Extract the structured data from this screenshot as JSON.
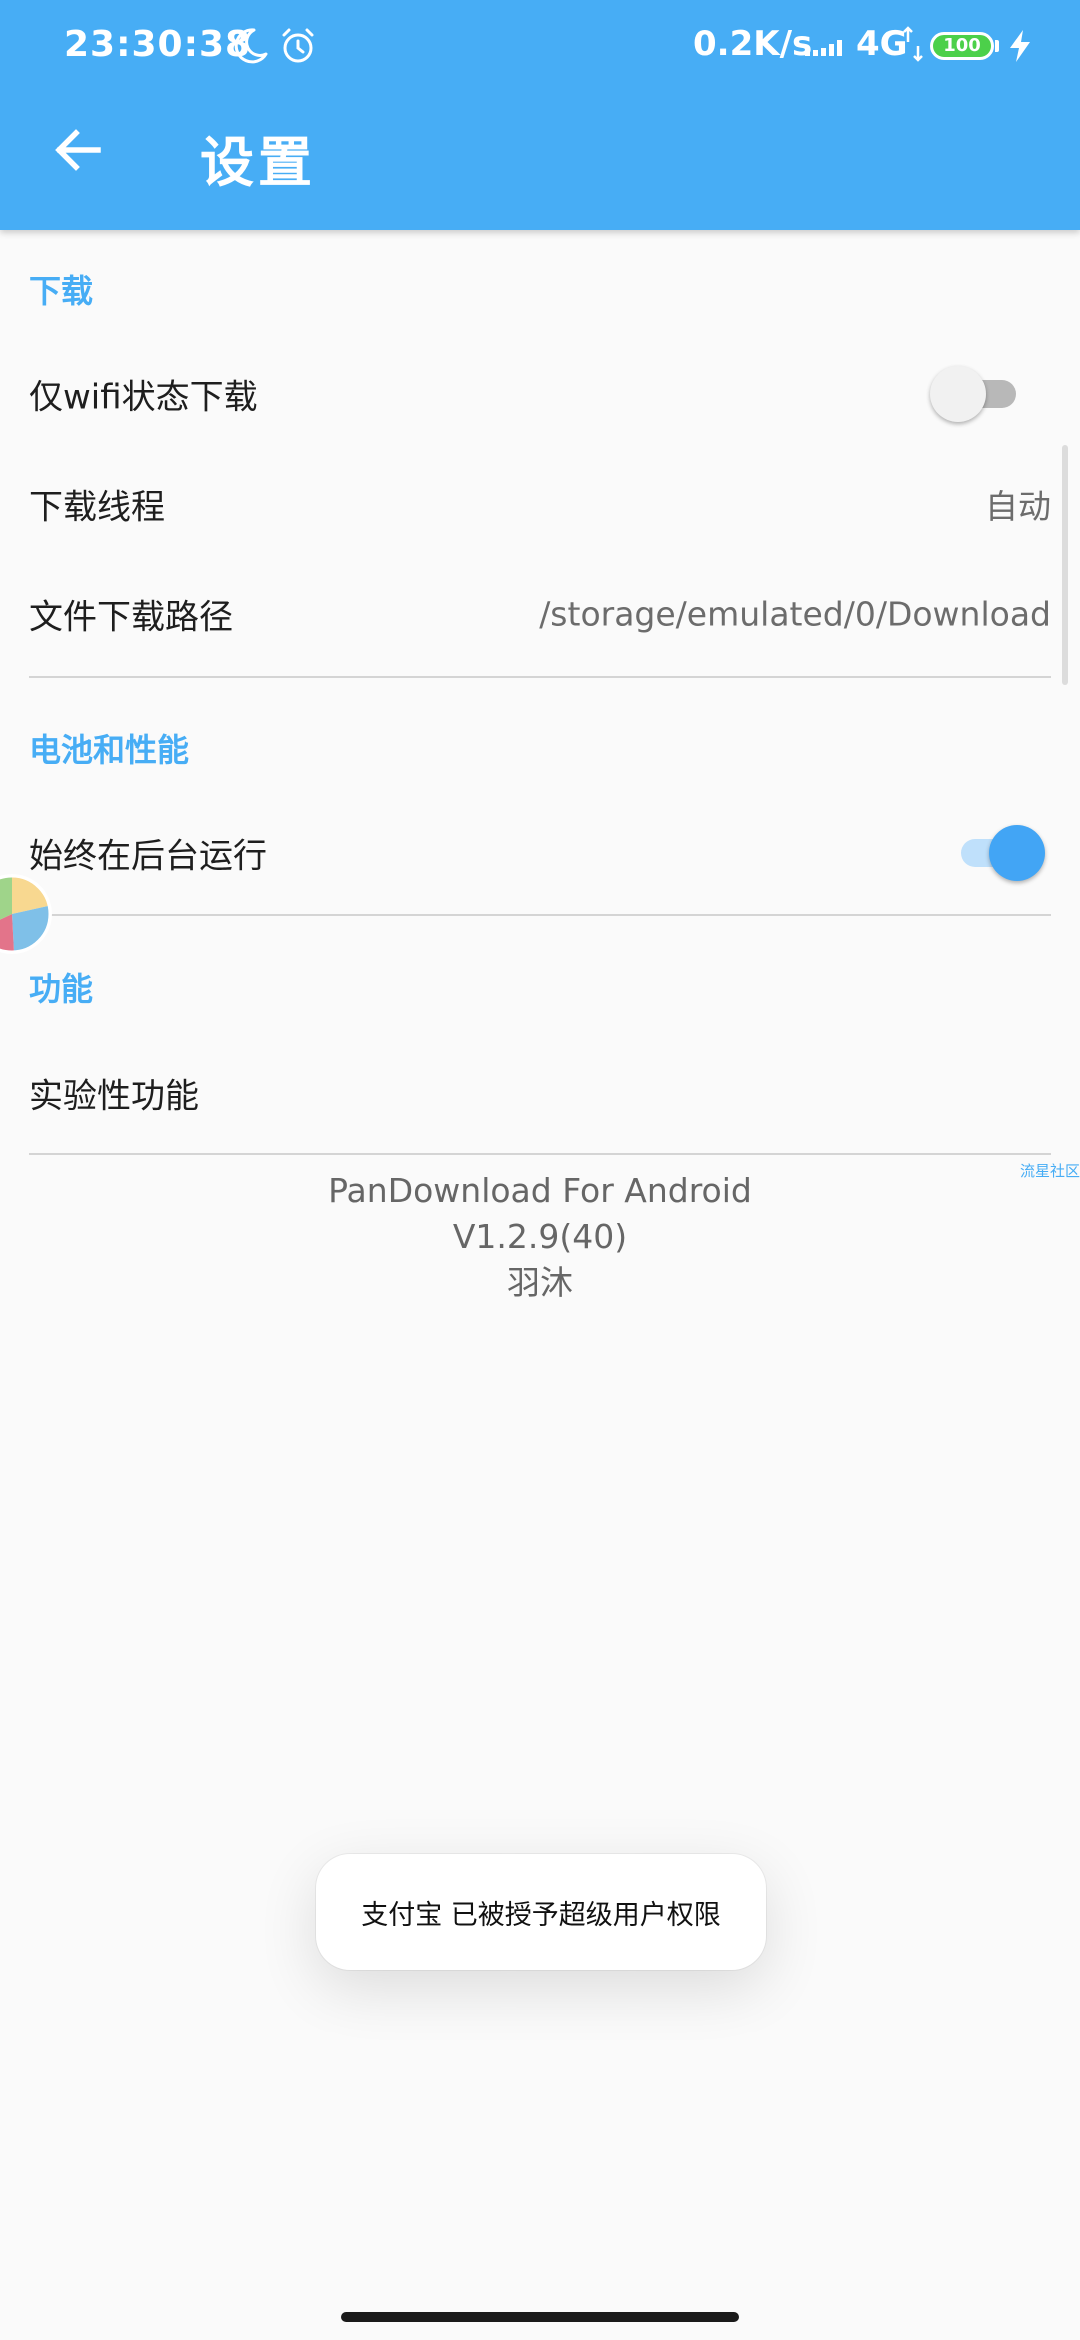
{
  "status_bar": {
    "time": "23:30:38",
    "net_speed": "0.2K/s",
    "network": "4G",
    "battery": "100",
    "icons": [
      "moon-icon",
      "alarm-icon",
      "signal-icon",
      "data-arrows-icon",
      "battery-icon",
      "charging-icon"
    ]
  },
  "app_bar": {
    "title": "设置",
    "back_icon": "arrow-left-icon"
  },
  "sections": {
    "download": {
      "header": "下载",
      "wifi_only": {
        "label": "仅wifi状态下载",
        "enabled": false
      },
      "threads": {
        "label": "下载线程",
        "value": "自动"
      },
      "path": {
        "label": "文件下载路径",
        "value": "/storage/emulated/0/Download"
      }
    },
    "battery": {
      "header": "电池和性能",
      "background_run": {
        "label": "始终在后台运行",
        "enabled": true
      }
    },
    "features": {
      "header": "功能",
      "experimental": {
        "label": "实验性功能"
      }
    }
  },
  "about": {
    "app_name": "PanDownload For Android",
    "version": "V1.2.9(40)",
    "author": "羽沐"
  },
  "watermark": "流星社区",
  "toast": "支付宝 已被授予超级用户权限",
  "colors": {
    "primary": "#47adf5",
    "switch_on": "#42a5f5",
    "background": "#fafafa"
  }
}
